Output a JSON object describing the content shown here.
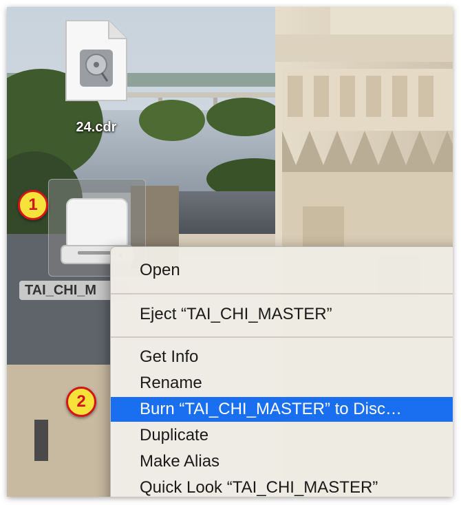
{
  "desktop": {
    "file_icon_label": "24.cdr",
    "drive_icon_label": "TAI_CHI_M"
  },
  "badges": {
    "step1": "1",
    "step2": "2"
  },
  "context_menu": {
    "items": [
      {
        "label": "Open"
      },
      {
        "label": "Eject “TAI_CHI_MASTER”"
      },
      {
        "label": "Get Info"
      },
      {
        "label": "Rename"
      },
      {
        "label": "Burn “TAI_CHI_MASTER” to Disc…",
        "highlighted": true
      },
      {
        "label": "Duplicate"
      },
      {
        "label": "Make Alias"
      },
      {
        "label": "Quick Look “TAI_CHI_MASTER”"
      }
    ],
    "highlight_color": "#1a6ff1"
  },
  "colors": {
    "badge_fill": "#f6e23a",
    "badge_border": "#d2141b"
  }
}
